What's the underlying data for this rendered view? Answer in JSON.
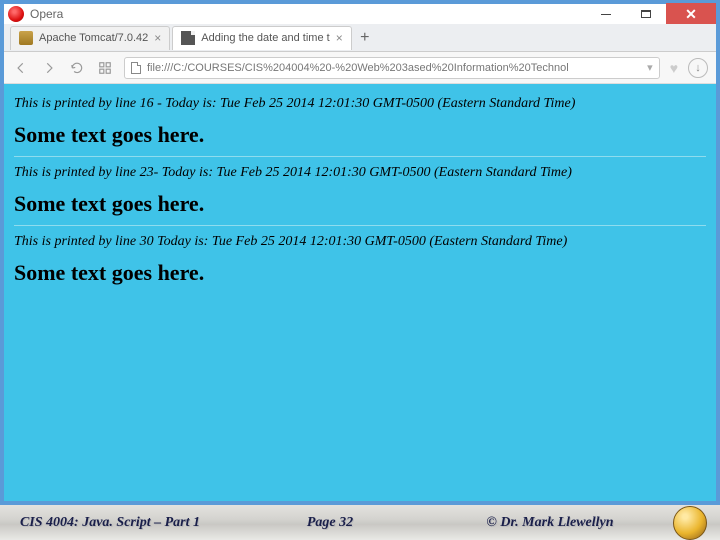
{
  "titlebar": {
    "app_name": "Opera"
  },
  "window_controls": {
    "close_glyph": "✕"
  },
  "tabs": {
    "tab1_label": "Apache Tomcat/7.0.42",
    "tab2_label": "Adding the date and time t",
    "close_glyph": "×",
    "newtab_glyph": "+"
  },
  "nav": {
    "url": "file:///C:/COURSES/CIS%204004%20-%20Web%203ased%20Information%20Technol",
    "download_glyph": "↓",
    "heart_glyph": "♥"
  },
  "page": {
    "line16": "This is printed by line 16 - Today is: Tue Feb 25 2014 12:01:30 GMT-0500 (Eastern Standard Time)",
    "header1": "Some text goes here.",
    "line23": "This is printed by line 23- Today is: Tue Feb 25 2014 12:01:30 GMT-0500 (Eastern Standard Time)",
    "header2": "Some text goes here.",
    "line30": "This is printed by line 30 Today is: Tue Feb 25 2014 12:01:30 GMT-0500 (Eastern Standard Time)",
    "header3": "Some text goes here."
  },
  "footer": {
    "left": "CIS 4004: Java. Script – Part 1",
    "center": "Page 32",
    "right": "© Dr. Mark Llewellyn"
  }
}
